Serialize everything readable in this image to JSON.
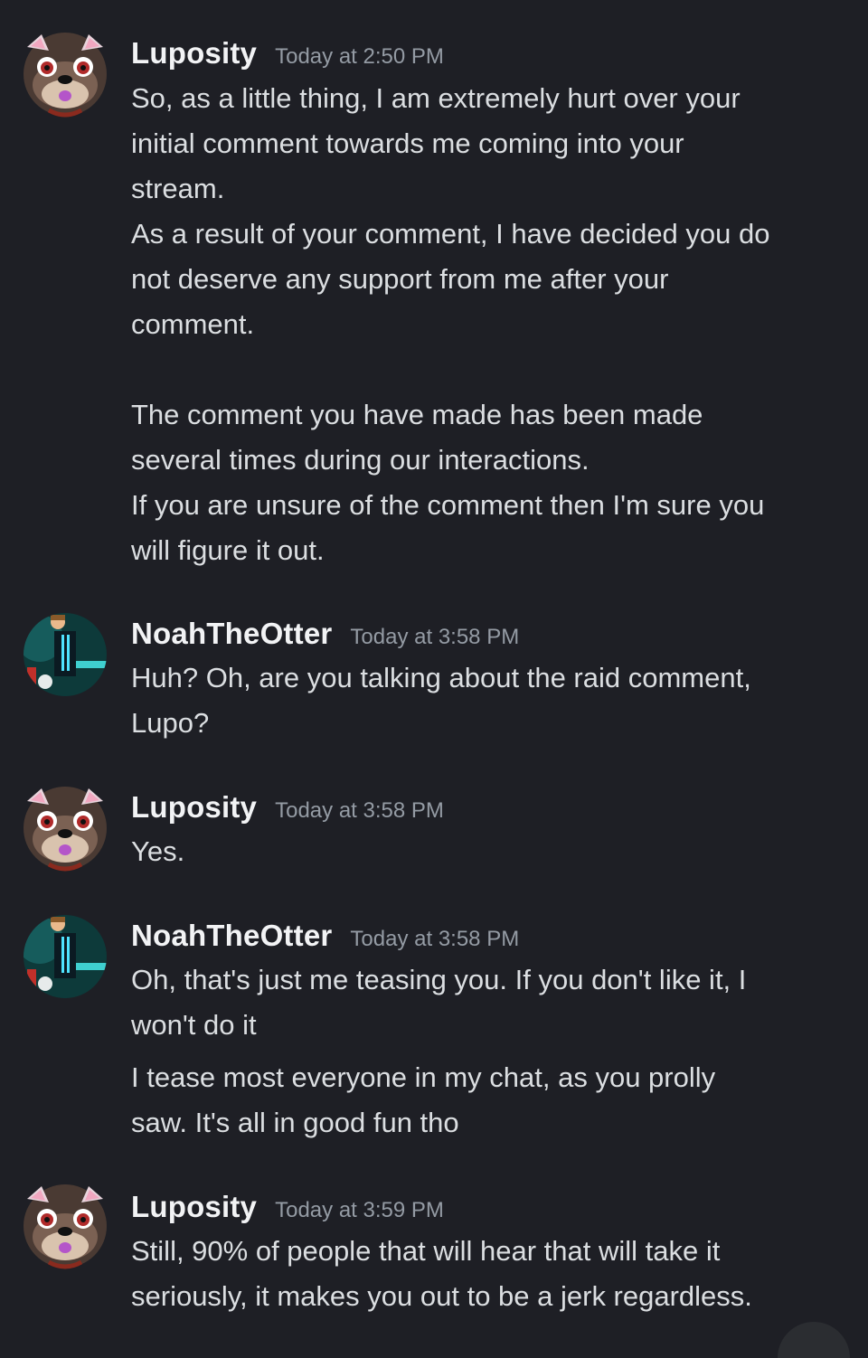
{
  "messages": [
    {
      "author": "Luposity",
      "timestamp": "Today at 2:50 PM",
      "lines": [
        "So, as a little thing, I am extremely hurt over your",
        "initial comment towards me coming into your",
        "stream.",
        "As a result of your comment, I have decided you do",
        "not deserve any support from me after your",
        "comment.",
        "The comment you have made has been made",
        "several times during our interactions.",
        "If you are unsure of the comment then I'm sure you",
        "will figure it out."
      ]
    },
    {
      "author": "NoahTheOtter",
      "timestamp": "Today at 3:58 PM",
      "lines": [
        "Huh? Oh, are you talking about the raid comment,",
        "Lupo?"
      ]
    },
    {
      "author": "Luposity",
      "timestamp": "Today at 3:58 PM",
      "lines": [
        "Yes."
      ]
    },
    {
      "author": "NoahTheOtter",
      "timestamp": "Today at 3:58 PM",
      "lines": [
        "Oh, that's just me teasing you. If you don't like it, I",
        "won't do it",
        "I tease most everyone in my chat, as you prolly",
        "saw. It's all in good fun tho"
      ]
    },
    {
      "author": "Luposity",
      "timestamp": "Today at 3:59 PM",
      "lines": [
        "Still, 90% of people that will hear that will take it",
        "seriously, it makes you out to be a jerk regardless."
      ]
    }
  ],
  "colors": {
    "background": "#1e1f25",
    "username": "#f2f3f5",
    "timestamp": "#949ba4",
    "text": "#dbdee1"
  },
  "icons": {
    "luposity_avatar": "otter-avatar-icon",
    "noah_avatar": "character-avatar-icon"
  }
}
